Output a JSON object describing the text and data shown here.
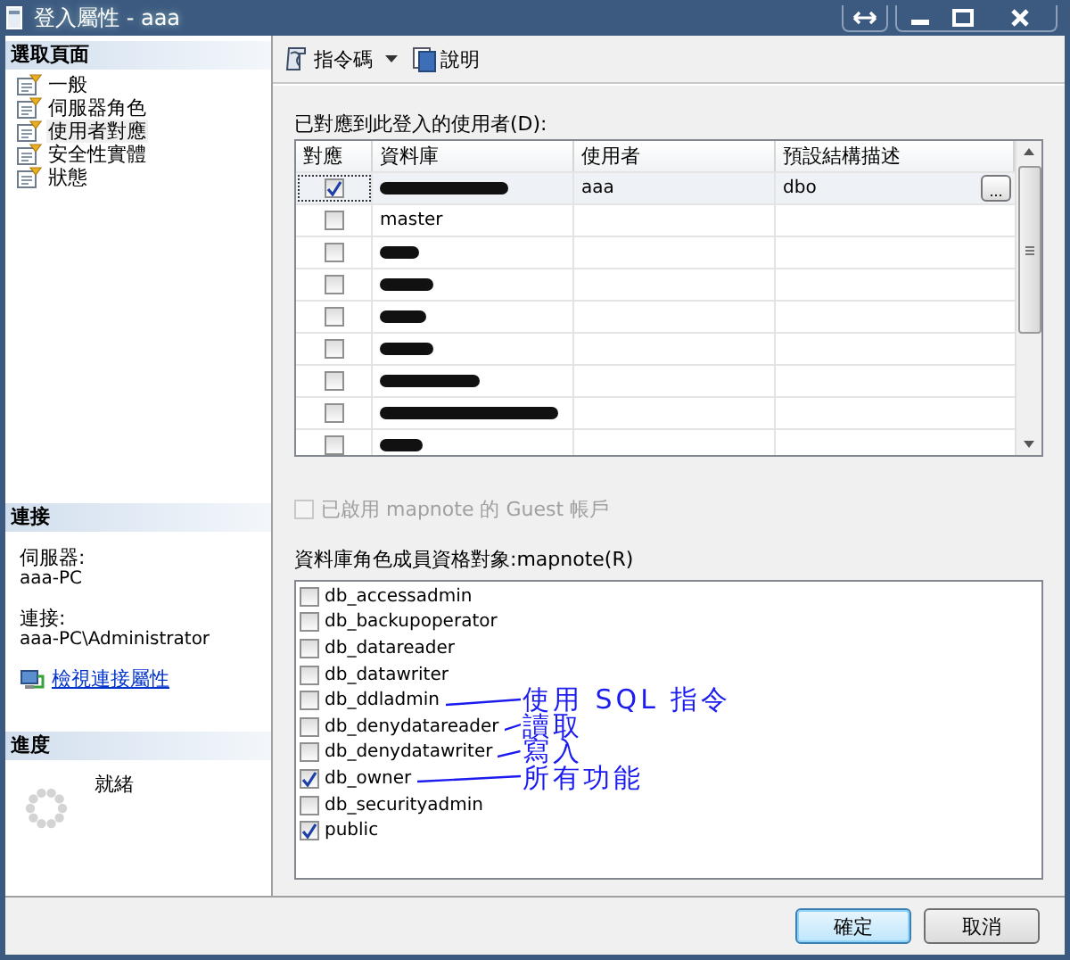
{
  "window": {
    "title": "登入屬性 - aaa"
  },
  "sidebar": {
    "header": "選取頁面",
    "items": [
      {
        "label": "一般",
        "selected": false
      },
      {
        "label": "伺服器角色",
        "selected": false
      },
      {
        "label": "使用者對應",
        "selected": true
      },
      {
        "label": "安全性實體",
        "selected": false
      },
      {
        "label": "狀態",
        "selected": false
      }
    ]
  },
  "connection": {
    "header": "連接",
    "server_label": "伺服器:",
    "server": "aaa-PC",
    "connection_label": "連接:",
    "connection": "aaa-PC\\Administrator",
    "link": "檢視連接屬性"
  },
  "progress": {
    "header": "進度",
    "status": "就緒"
  },
  "toolbar": {
    "items": [
      {
        "label": "指令碼",
        "kind": "script",
        "dropdown": true
      },
      {
        "label": "說明",
        "kind": "help",
        "dropdown": false
      }
    ]
  },
  "mapping": {
    "label": "已對應到此登入的使用者(D):",
    "columns": [
      "對應",
      "資料庫",
      "使用者",
      "預設結構描述"
    ],
    "rows": [
      {
        "mapped": true,
        "selected": true,
        "redacted": true,
        "user": "aaa",
        "schema": "dbo",
        "browse_button": "..."
      },
      {
        "mapped": false,
        "selected": false,
        "redacted": false,
        "database": "master"
      },
      {
        "mapped": false,
        "selected": false,
        "redacted": true
      },
      {
        "mapped": false,
        "selected": false,
        "redacted": true
      },
      {
        "mapped": false,
        "selected": false,
        "redacted": true
      },
      {
        "mapped": false,
        "selected": false,
        "redacted": true
      },
      {
        "mapped": false,
        "selected": false,
        "redacted": true
      },
      {
        "mapped": false,
        "selected": false,
        "redacted": true
      },
      {
        "mapped": false,
        "selected": false,
        "redacted": true
      }
    ]
  },
  "guest": {
    "label": "已啟用 mapnote 的 Guest 帳戶",
    "checked": false,
    "disabled": true
  },
  "roles": {
    "label": "資料庫角色成員資格對象:mapnote(R)",
    "items": [
      {
        "name": "db_accessadmin",
        "checked": false
      },
      {
        "name": "db_backupoperator",
        "checked": false
      },
      {
        "name": "db_datareader",
        "checked": false
      },
      {
        "name": "db_datawriter",
        "checked": false
      },
      {
        "name": "db_ddladmin",
        "checked": false,
        "note": "使用 SQL 指令"
      },
      {
        "name": "db_denydatareader",
        "checked": false,
        "note": "讀取"
      },
      {
        "name": "db_denydatawriter",
        "checked": false,
        "note": "寫入"
      },
      {
        "name": "db_owner",
        "checked": true,
        "note": "所有功能"
      },
      {
        "name": "db_securityadmin",
        "checked": false
      },
      {
        "name": "public",
        "checked": true
      }
    ]
  },
  "buttons": [
    {
      "label": "確定",
      "default": true
    },
    {
      "label": "取消",
      "default": false
    }
  ]
}
